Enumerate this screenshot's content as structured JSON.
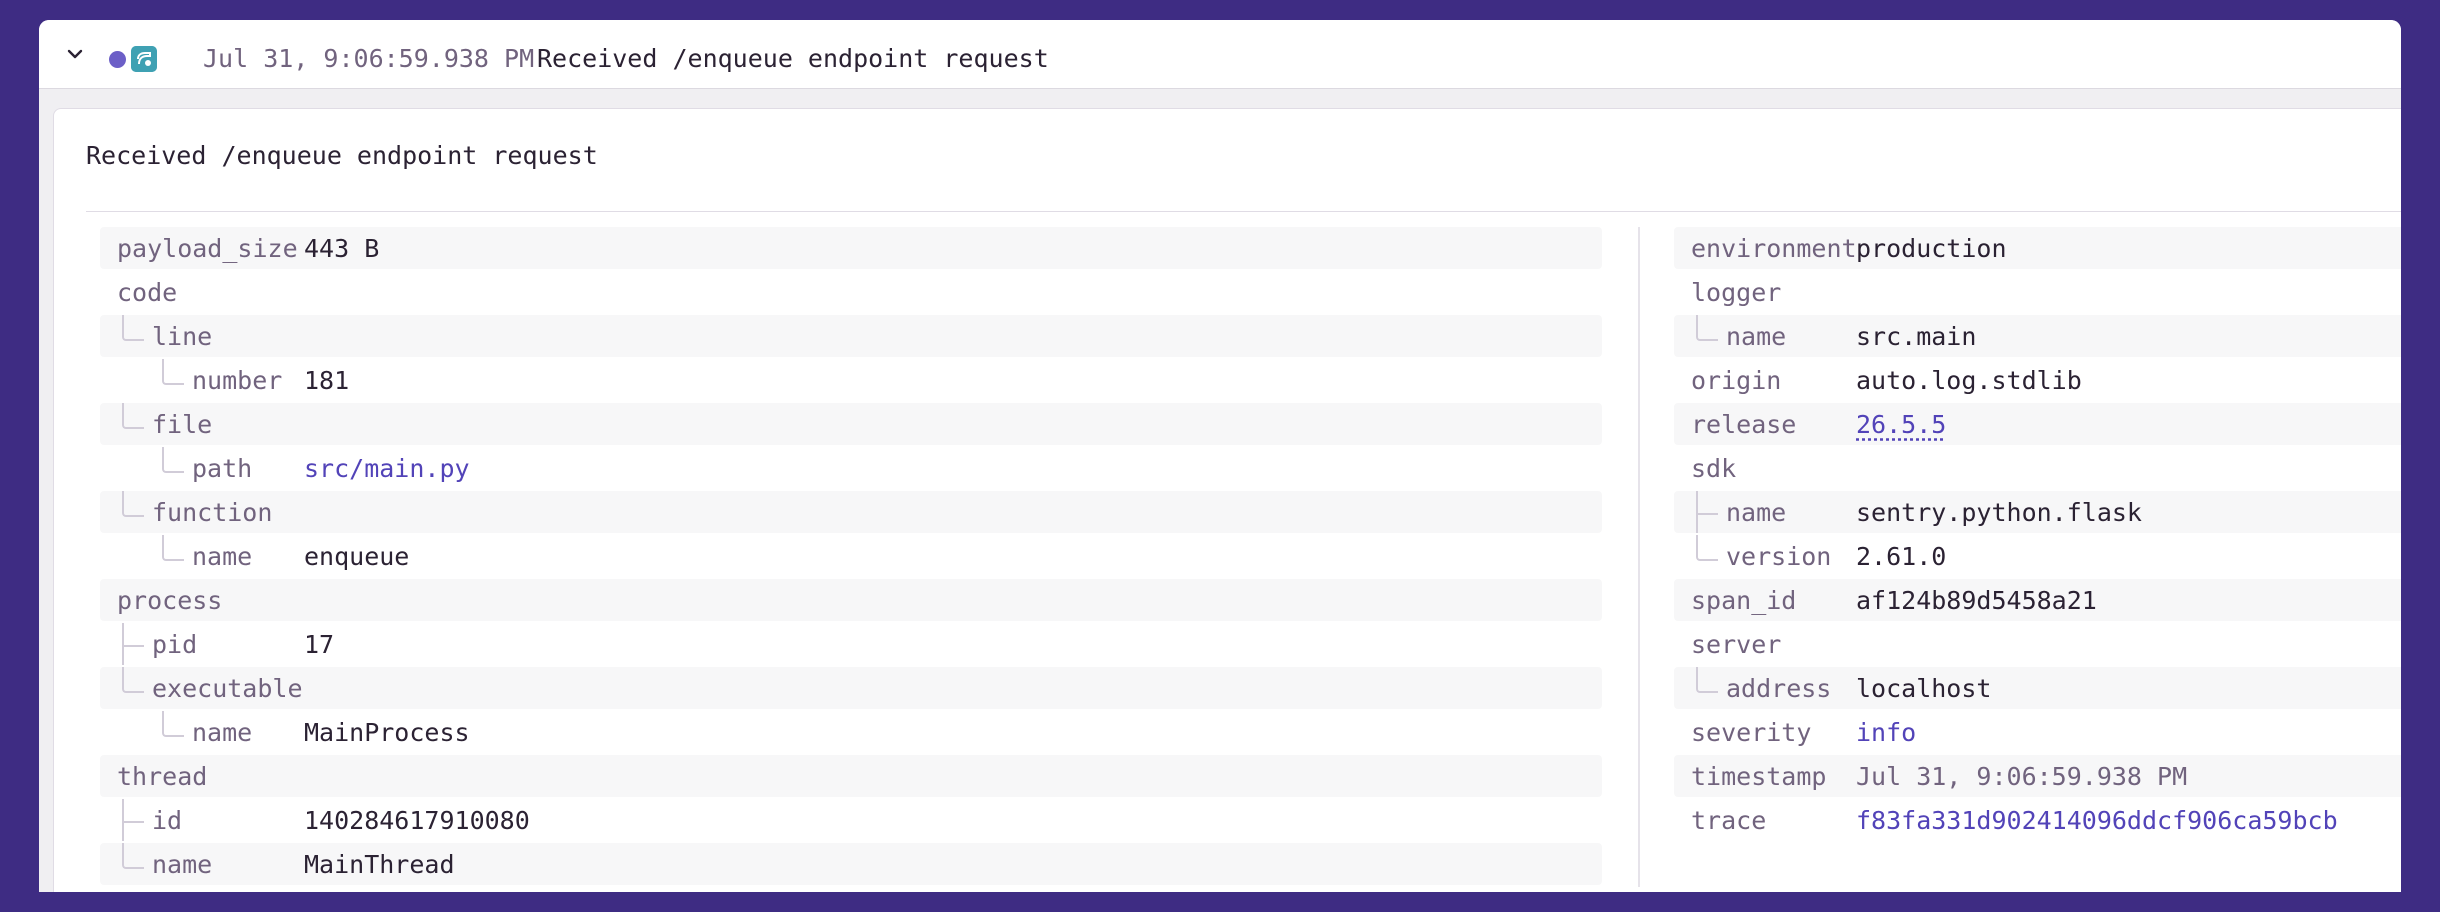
{
  "header": {
    "timestamp": "Jul 31, 9:06:59.938 PM",
    "message": "Received /enqueue endpoint request",
    "chevron_icon": "chevron-down-icon",
    "status_dot_color": "#6c5fc7",
    "platform_icon": "python-icon"
  },
  "card": {
    "title": "Received /enqueue endpoint request"
  },
  "left_attributes": [
    {
      "key": "payload_size",
      "value": "443 B"
    },
    {
      "key": "code",
      "value": ""
    },
    {
      "key": "line",
      "value": ""
    },
    {
      "key": "number",
      "value": "181"
    },
    {
      "key": "file",
      "value": ""
    },
    {
      "key": "path",
      "value": "src/main.py"
    },
    {
      "key": "function",
      "value": ""
    },
    {
      "key": "name",
      "value": "enqueue"
    },
    {
      "key": "process",
      "value": ""
    },
    {
      "key": "pid",
      "value": "17"
    },
    {
      "key": "executable",
      "value": ""
    },
    {
      "key": "name",
      "value": "MainProcess"
    },
    {
      "key": "thread",
      "value": ""
    },
    {
      "key": "id",
      "value": "140284617910080"
    },
    {
      "key": "name",
      "value": "MainThread"
    }
  ],
  "right_attributes": [
    {
      "key": "environment",
      "value": "production"
    },
    {
      "key": "logger",
      "value": ""
    },
    {
      "key": "name",
      "value": "src.main"
    },
    {
      "key": "origin",
      "value": "auto.log.stdlib"
    },
    {
      "key": "release",
      "value": "26.5.5"
    },
    {
      "key": "sdk",
      "value": ""
    },
    {
      "key": "name",
      "value": "sentry.python.flask"
    },
    {
      "key": "version",
      "value": "2.61.0"
    },
    {
      "key": "span_id",
      "value": "af124b89d5458a21"
    },
    {
      "key": "server",
      "value": ""
    },
    {
      "key": "address",
      "value": "localhost"
    },
    {
      "key": "severity",
      "value": "info"
    },
    {
      "key": "timestamp",
      "value": "Jul 31, 9:06:59.938 PM"
    },
    {
      "key": "trace",
      "value": "f83fa331d902414096ddcf906ca59bcb"
    }
  ]
}
